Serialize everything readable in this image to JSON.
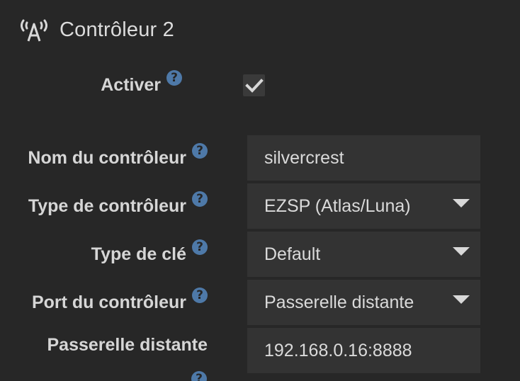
{
  "section": {
    "title": "Contrôleur 2",
    "icon": "antenna-icon"
  },
  "help_glyph": "?",
  "enable": {
    "label": "Activer",
    "checked": true
  },
  "fields": {
    "name": {
      "label": "Nom du contrôleur",
      "value": "silvercrest"
    },
    "type": {
      "label": "Type de contrôleur",
      "value": "EZSP (Atlas/Luna)"
    },
    "key_type": {
      "label": "Type de clé",
      "value": "Default"
    },
    "port": {
      "label": "Port du contrôleur",
      "value": "Passerelle distante"
    },
    "remote": {
      "label": "Passerelle distante",
      "value": "192.168.0.16:8888"
    }
  },
  "colors": {
    "background": "#272727",
    "field": "#333333",
    "help": "#4e79a8",
    "text": "#d6d6d6"
  }
}
